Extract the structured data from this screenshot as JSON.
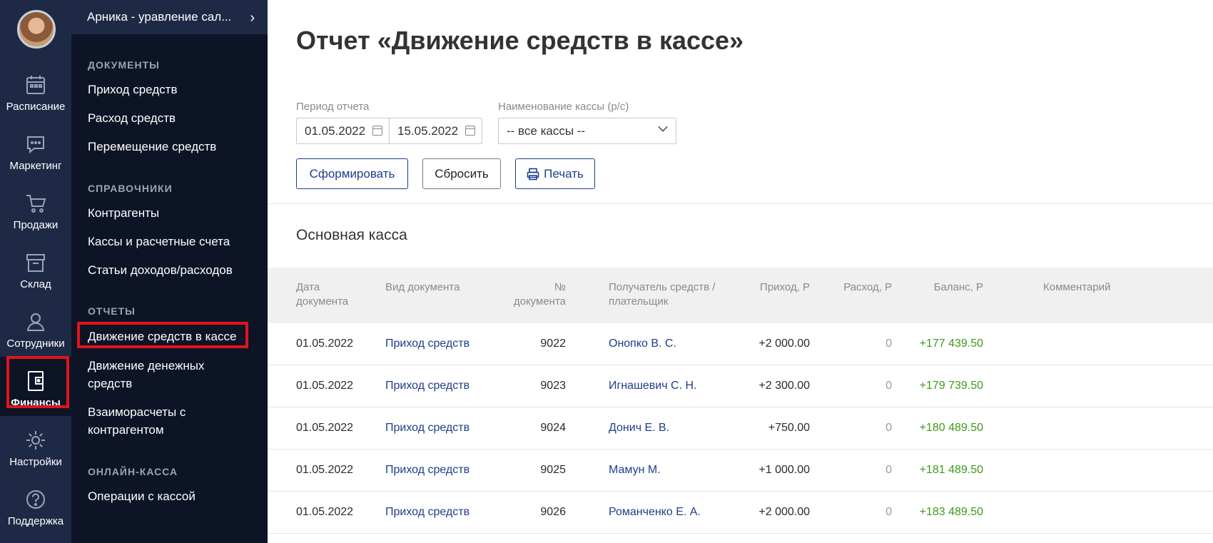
{
  "rail": {
    "items": [
      {
        "label": "Расписание",
        "icon": "calendar-icon"
      },
      {
        "label": "Маркетинг",
        "icon": "chat-icon"
      },
      {
        "label": "Продажи",
        "icon": "cart-icon"
      },
      {
        "label": "Склад",
        "icon": "box-icon"
      },
      {
        "label": "Сотрудники",
        "icon": "user-icon"
      },
      {
        "label": "Финансы",
        "icon": "wallet-icon"
      },
      {
        "label": "Настройки",
        "icon": "gear-icon"
      },
      {
        "label": "Поддержка",
        "icon": "help-icon"
      }
    ]
  },
  "menu": {
    "org": "Арника - уравление сал...",
    "sections": [
      {
        "title": "ДОКУМЕНТЫ",
        "links": [
          "Приход средств",
          "Расход средств",
          "Перемещение средств"
        ]
      },
      {
        "title": "СПРАВОЧНИКИ",
        "links": [
          "Контрагенты",
          "Кассы и расчетные счета",
          "Статьи доходов/расходов"
        ]
      },
      {
        "title": "ОТЧЕТЫ",
        "links": [
          "Движение средств в кассе",
          "Движение денежных средств",
          "Взаиморасчеты с контрагентом"
        ]
      },
      {
        "title": "ОНЛАЙН-КАССА",
        "links": [
          "Операции с кассой"
        ]
      }
    ]
  },
  "page": {
    "title": "Отчет «Движение средств в кассе»",
    "period_label": "Период отчета",
    "date_from": "01.05.2022",
    "date_to": "15.05.2022",
    "cash_label": "Наименование кассы (р/с)",
    "cash_value": "-- все кассы --",
    "btn_generate": "Сформировать",
    "btn_reset": "Сбросить",
    "btn_print": "Печать",
    "section_title": "Основная касса"
  },
  "table": {
    "headers": {
      "date": [
        "Дата",
        "документа"
      ],
      "type": "Вид документа",
      "num": [
        "№",
        "документа"
      ],
      "payer": [
        "Получатель средств /",
        "плательщик"
      ],
      "income": "Приход, Р",
      "expense": "Расход, Р",
      "balance": "Баланс, Р",
      "comment": "Комментарий"
    },
    "rows": [
      {
        "date": "01.05.2022",
        "type": "Приход средств",
        "num": "9022",
        "payer": "Онопко В. С.",
        "income": "+2 000.00",
        "expense": "0",
        "balance": "+177 439.50"
      },
      {
        "date": "01.05.2022",
        "type": "Приход средств",
        "num": "9023",
        "payer": "Игнашевич С. Н.",
        "income": "+2 300.00",
        "expense": "0",
        "balance": "+179 739.50"
      },
      {
        "date": "01.05.2022",
        "type": "Приход средств",
        "num": "9024",
        "payer": "Донич Е. В.",
        "income": "+750.00",
        "expense": "0",
        "balance": "+180 489.50"
      },
      {
        "date": "01.05.2022",
        "type": "Приход средств",
        "num": "9025",
        "payer": "Мамун М.",
        "income": "+1 000.00",
        "expense": "0",
        "balance": "+181 489.50"
      },
      {
        "date": "01.05.2022",
        "type": "Приход средств",
        "num": "9026",
        "payer": "Романченко Е. А.",
        "income": "+2 000.00",
        "expense": "0",
        "balance": "+183 489.50"
      }
    ]
  },
  "colors": {
    "rail": "#1e2a45",
    "menu": "#0d1426",
    "link": "#1f3d8a",
    "positive": "#3f9a1b",
    "highlight": "#e0141b"
  }
}
